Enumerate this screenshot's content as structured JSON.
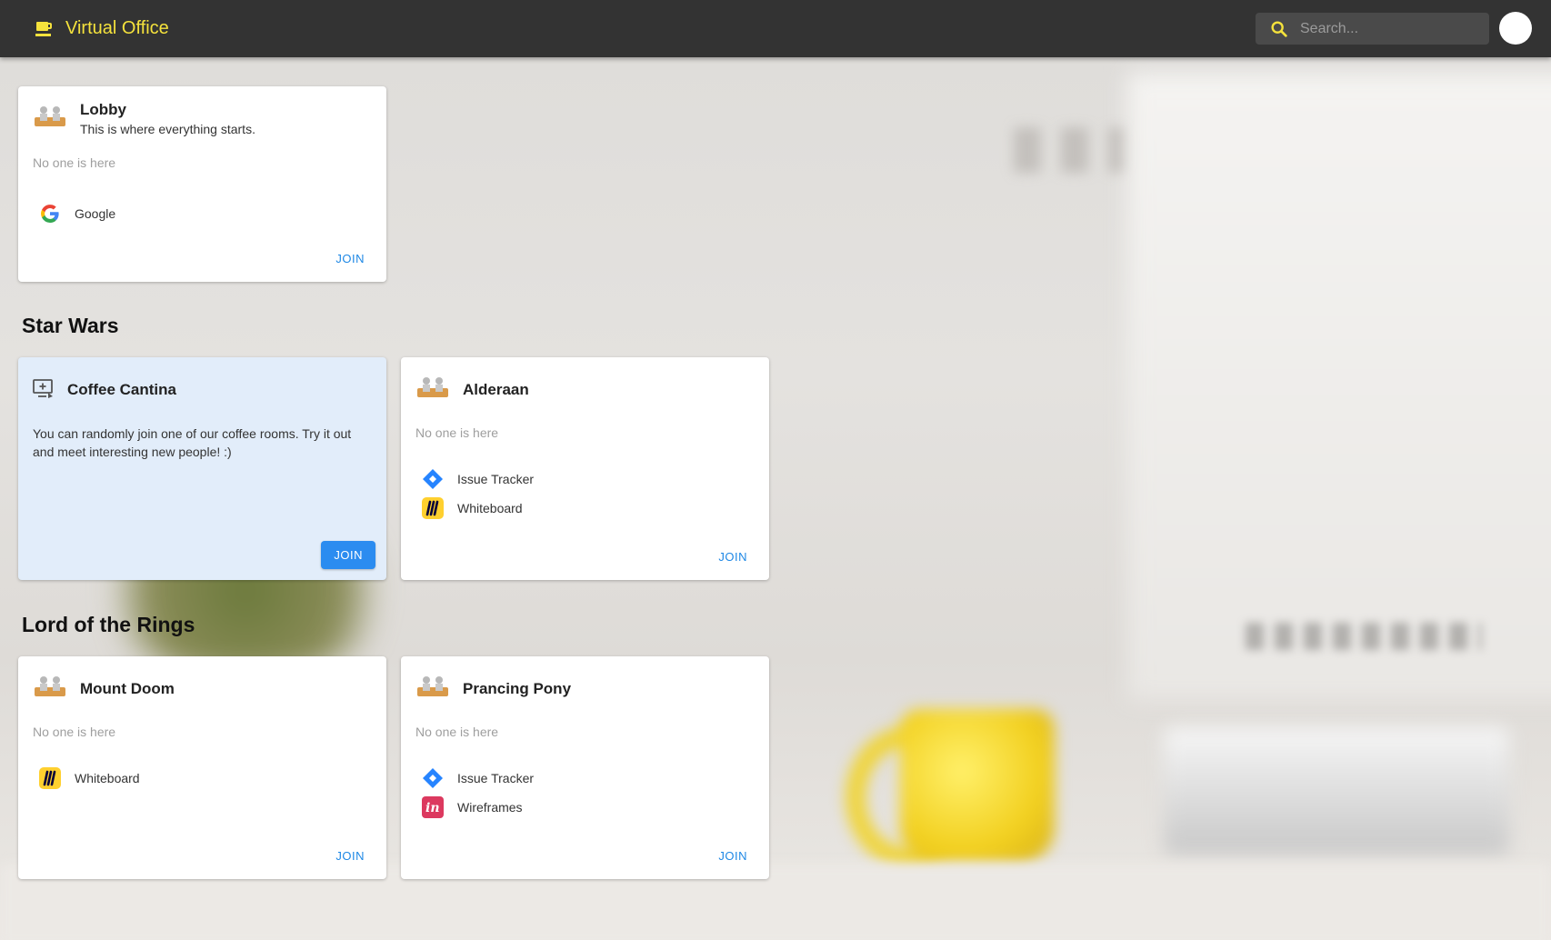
{
  "app": {
    "title": "Virtual Office",
    "search_placeholder": "Search..."
  },
  "colors": {
    "appbar": "#333333",
    "brand": "#f5e23c",
    "join": "#1e88e5",
    "highlight_card": "#e2edfa"
  },
  "lobby": {
    "name": "Lobby",
    "description": "This is where everything starts.",
    "status": "No one is here",
    "tools": [
      {
        "label": "Google",
        "icon": "google-icon"
      }
    ],
    "join_label": "JOIN"
  },
  "groups": [
    {
      "title": "Star Wars",
      "rooms": [
        {
          "name": "Coffee Cantina",
          "icon": "random-room-icon",
          "text": "You can randomly join one of our coffee rooms. Try it out and meet interesting new people! :)",
          "join_label": "JOIN"
        },
        {
          "name": "Alderaan",
          "icon": "meeting-room-icon",
          "status": "No one is here",
          "tools": [
            {
              "label": "Issue Tracker",
              "icon": "jira-icon"
            },
            {
              "label": "Whiteboard",
              "icon": "miro-icon"
            }
          ],
          "join_label": "JOIN"
        }
      ]
    },
    {
      "title": "Lord of the Rings",
      "rooms": [
        {
          "name": "Mount Doom",
          "icon": "meeting-room-icon",
          "status": "No one is here",
          "tools": [
            {
              "label": "Whiteboard",
              "icon": "miro-icon"
            }
          ],
          "join_label": "JOIN"
        },
        {
          "name": "Prancing Pony",
          "icon": "meeting-room-icon",
          "status": "No one is here",
          "tools": [
            {
              "label": "Issue Tracker",
              "icon": "jira-icon"
            },
            {
              "label": "Wireframes",
              "icon": "invision-icon"
            }
          ],
          "join_label": "JOIN"
        }
      ]
    }
  ]
}
